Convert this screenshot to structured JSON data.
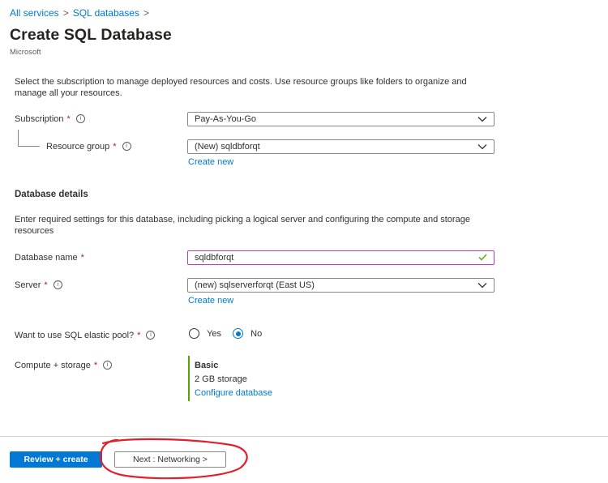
{
  "breadcrumb": {
    "items": [
      "All services",
      "SQL databases"
    ],
    "separator": ">"
  },
  "header": {
    "title": "Create SQL Database",
    "publisher": "Microsoft"
  },
  "project": {
    "intro": "Select the subscription to manage deployed resources and costs. Use resource groups like folders to organize and manage all your resources.",
    "subscription": {
      "label": "Subscription",
      "value": "Pay-As-You-Go"
    },
    "resource_group": {
      "label": "Resource group",
      "value": "(New) sqldbforqt",
      "create_new": "Create new"
    }
  },
  "database_details": {
    "heading": "Database details",
    "intro": "Enter required settings for this database, including picking a logical server and configuring the compute and storage resources",
    "database_name": {
      "label": "Database name",
      "value": "sqldbforqt",
      "valid": true
    },
    "server": {
      "label": "Server",
      "value": "(new) sqlserverforqt (East US)",
      "create_new": "Create new"
    },
    "elastic_pool": {
      "label": "Want to use SQL elastic pool?",
      "options": [
        "Yes",
        "No"
      ],
      "selected": "No"
    },
    "compute_storage": {
      "label": "Compute + storage",
      "tier": "Basic",
      "storage": "2 GB storage",
      "configure_link": "Configure database"
    }
  },
  "markers": {
    "required": "*",
    "info_glyph": "i"
  },
  "footer": {
    "review_create": "Review + create",
    "next": "Next : Networking >"
  },
  "colors": {
    "accent": "#0078d4",
    "required": "#a4262c",
    "valid_border": "#c239b3",
    "valid_check": "#57a300",
    "annotation": "#e0202a"
  },
  "icons": [
    "chevron-down-icon",
    "info-icon",
    "checkmark-icon"
  ]
}
